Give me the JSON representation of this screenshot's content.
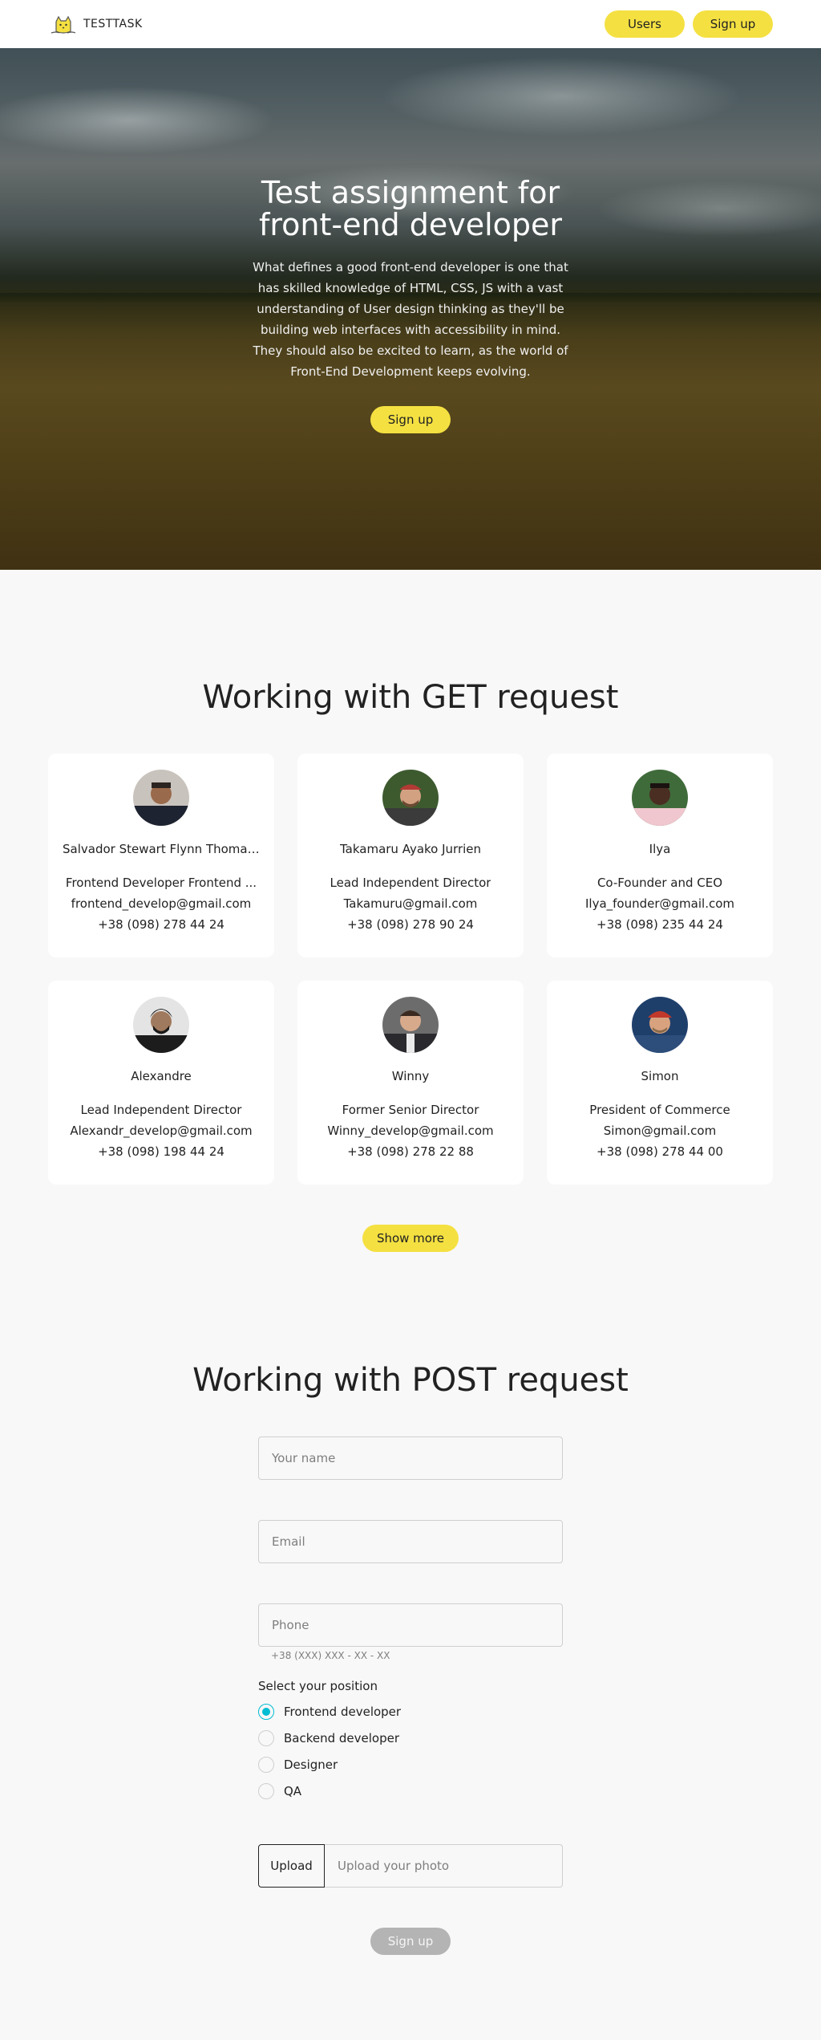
{
  "header": {
    "logo_text": "TESTTASK",
    "nav": {
      "users_label": "Users",
      "signup_label": "Sign up"
    }
  },
  "hero": {
    "title": "Test assignment for front-end developer",
    "text": "What defines a good front-end developer is one that has skilled knowledge of HTML, CSS, JS with a vast understanding of User design thinking as they'll be building web interfaces with accessibility in mind. They should also be excited to learn, as the world of Front-End Development keeps evolving.",
    "button_label": "Sign up"
  },
  "get_section": {
    "title": "Working with GET request",
    "users": [
      {
        "name": "Salvador Stewart Flynn Thomas...",
        "position": "Frontend Developer Frontend ...",
        "email": "frontend_develop@gmail.com",
        "phone": "+38 (098) 278 44 24",
        "avatar": "avatar-photo"
      },
      {
        "name": "Takamaru Ayako Jurrien",
        "position": "Lead Independent Director",
        "email": "Takamuru@gmail.com",
        "phone": "+38 (098) 278 90 24",
        "avatar": "avatar-photo"
      },
      {
        "name": "Ilya",
        "position": "Co-Founder and CEO",
        "email": "Ilya_founder@gmail.com",
        "phone": "+38 (098) 235 44 24",
        "avatar": "avatar-photo"
      },
      {
        "name": "Alexandre",
        "position": "Lead Independent Director",
        "email": "Alexandr_develop@gmail.com",
        "phone": "+38 (098) 198 44 24",
        "avatar": "avatar-photo"
      },
      {
        "name": "Winny",
        "position": "Former Senior Director",
        "email": "Winny_develop@gmail.com",
        "phone": "+38 (098) 278 22 88",
        "avatar": "avatar-photo"
      },
      {
        "name": "Simon",
        "position": "President of Commerce",
        "email": "Simon@gmail.com",
        "phone": "+38 (098) 278 44 00",
        "avatar": "avatar-photo"
      }
    ],
    "show_more_label": "Show more"
  },
  "post_section": {
    "title": "Working with POST request",
    "name_placeholder": "Your name",
    "email_placeholder": "Email",
    "phone_placeholder": "Phone",
    "phone_helper": "+38 (XXX) XXX - XX - XX",
    "position_title": "Select your position",
    "positions": [
      {
        "label": "Frontend developer",
        "checked": true
      },
      {
        "label": "Backend developer",
        "checked": false
      },
      {
        "label": "Designer",
        "checked": false
      },
      {
        "label": "QA",
        "checked": false
      }
    ],
    "upload_button_label": "Upload",
    "upload_placeholder": "Upload your photo",
    "submit_label": "Sign up"
  },
  "colors": {
    "accent": "#f4e041",
    "radio_active": "#00bdd3",
    "disabled_button": "#b4b4b4",
    "background": "#f8f8f8"
  }
}
